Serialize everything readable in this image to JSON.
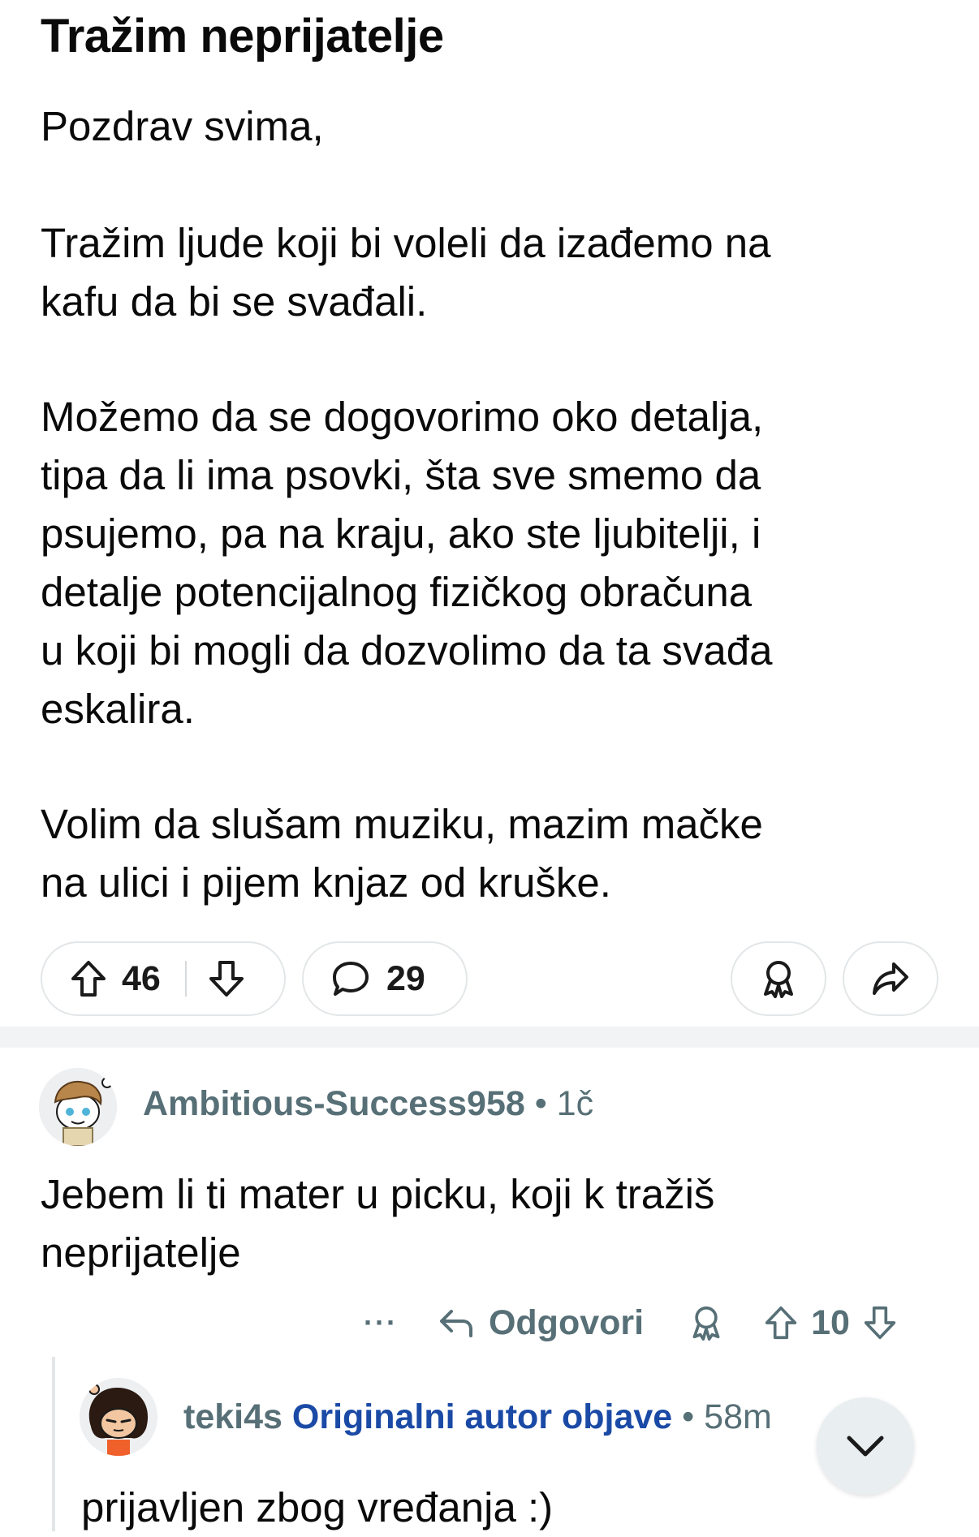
{
  "post": {
    "title": "Tražim neprijatelje",
    "paragraphs": [
      [
        "Pozdrav svima,"
      ],
      [
        "Tražim ljude koji bi voleli da izađemo na",
        "kafu da bi se svađali."
      ],
      [
        "Možemo da se dogovorimo oko detalja,",
        "tipa da li ima psovki, šta sve smemo da",
        "psujemo, pa na kraju, ako ste ljubitelji, i",
        "detalje potencijalnog fizičkog obračuna",
        "u koji bi mogli da dozvolimo da ta svađa",
        "eskalira."
      ],
      [
        "Volim da slušam muziku, mazim mačke",
        "na ulici i pijem knjaz od kruške."
      ]
    ],
    "upvotes": "46",
    "comments": "29"
  },
  "comment1": {
    "author": "Ambitious-Success958",
    "separator": "•",
    "time": "1č",
    "text_lines": [
      "Jebem li ti mater u picku, koji k tražiš",
      "neprijatelje"
    ],
    "more": "···",
    "reply_label": "Odgovori",
    "votes": "10"
  },
  "reply1": {
    "author": "teki4s",
    "badge": "Originalni autor objave",
    "separator": "•",
    "time": "58m",
    "text_lines": [
      "prijavljen zbog vređanja :)"
    ]
  },
  "colors": {
    "text": "#0a0a0a",
    "meta": "#576f76",
    "op_badge": "#1a4aa6",
    "border": "#e3e6e8",
    "divider": "#f1f3f4"
  }
}
